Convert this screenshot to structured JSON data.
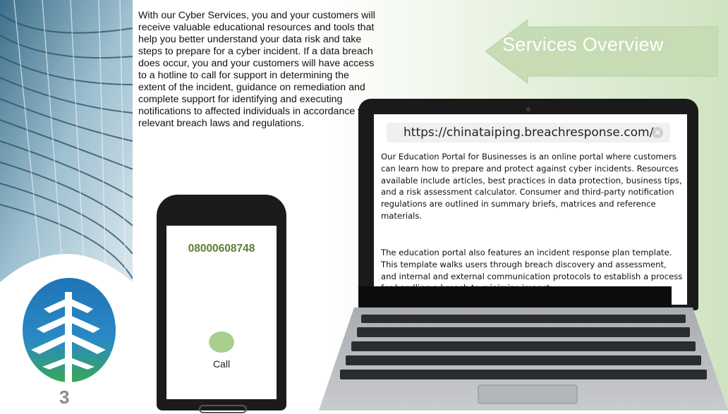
{
  "intro": {
    "text": "With our Cyber Services, you and your customers will receive valuable educational resources and tools that help you better understand your data risk and take steps to prepare for a cyber incident. If a data breach does occur, you and your customers will have access to a hotline to call for support in determining the extent of the incident, guidance on remediation and complete support for identifying and executing notifications to affected individuals in accordance with relevant breach laws and regulations."
  },
  "header": {
    "title": "Services Overview"
  },
  "phone": {
    "number": "08000608748",
    "call_label": "Call"
  },
  "browser": {
    "url": "https://chinataiping.breachresponse.com/",
    "clear_glyph": "✕",
    "paragraph1": "Our Education Portal for Businesses is an online portal where customers can learn how to prepare and protect against cyber incidents. Resources available include articles, best practices in data protection, business tips, and  a risk assessment calculator. Consumer and third-party notification regulations are outlined in summary briefs, matrices and reference materials.",
    "paragraph2": "The education portal also features an incident response plan template. This template walks users through breach discovery and assessment, and internal and external communication protocols to establish a process for handling a breach to minimise impact."
  },
  "page": {
    "number": "3"
  },
  "colors": {
    "accent_green": "#5c7f33",
    "call_button": "#a9cf8c",
    "arrow": "#c6dcb5"
  }
}
